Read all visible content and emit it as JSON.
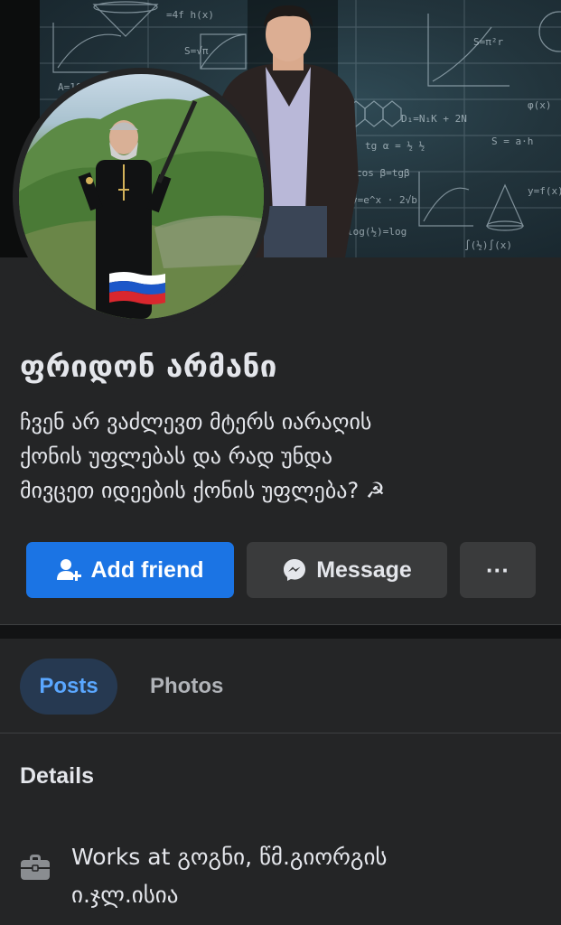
{
  "profile": {
    "name": "ფრიდონ არმანი",
    "bio_lines": [
      "ჩვენ არ ვაძლევთ მტერს იარაღის",
      "ქონის უფლებას და რად უნდა",
      "მივცეთ იდეების ქონის უფლება? ☭"
    ]
  },
  "actions": {
    "add_friend": "Add friend",
    "message": "Message",
    "more": "···"
  },
  "tabs": {
    "posts": "Posts",
    "photos": "Photos",
    "active": "posts"
  },
  "details": {
    "title": "Details",
    "works_prefix": "Works at ",
    "works_place_line1": "გოგნი, წმ.გიორგის",
    "works_place_line2": "ი.ჯლ.ისია"
  },
  "colors": {
    "background": "#242526",
    "primary_button": "#1b74e4",
    "secondary_button": "#3a3b3c",
    "active_tab_bg": "#263951",
    "active_tab_text": "#5aa7ff"
  },
  "icons": {
    "add_friend": "person-add-icon",
    "message": "messenger-icon",
    "work": "briefcase-icon",
    "flag": "russia-flag-emoji"
  }
}
